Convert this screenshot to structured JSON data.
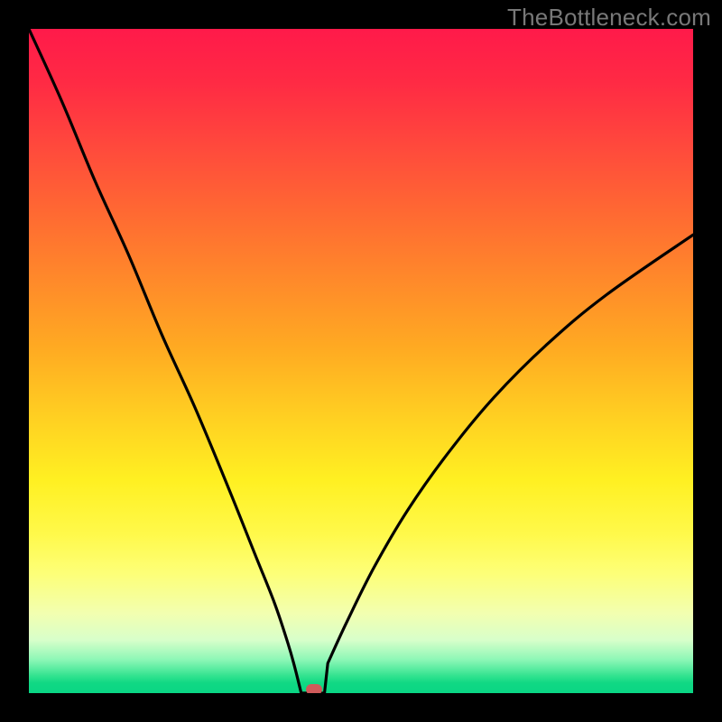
{
  "watermark": "TheBottleneck.com",
  "colors": {
    "frame": "#000000",
    "curve": "#000000",
    "marker": "#cf5a5a",
    "gradient_top": "#ff1a4a",
    "gradient_bottom": "#0ad684"
  },
  "chart_data": {
    "type": "line",
    "title": "",
    "xlabel": "",
    "ylabel": "",
    "xlim": [
      0,
      100
    ],
    "ylim": [
      0,
      100
    ],
    "grid": false,
    "legend": false,
    "x_min": 41,
    "marker": {
      "x": 43,
      "y": 0
    },
    "series": [
      {
        "name": "bottleneck_curve",
        "x": [
          0,
          5,
          10,
          15,
          20,
          25,
          30,
          34,
          37,
          39,
          40,
          41,
          43,
          45,
          48,
          52,
          57,
          63,
          70,
          78,
          87,
          100
        ],
        "y": [
          100,
          89,
          77,
          66,
          54,
          43,
          31,
          21,
          13.5,
          7.5,
          4,
          0,
          0,
          4.5,
          11,
          19,
          27.5,
          36,
          44.5,
          52.5,
          60,
          69
        ]
      }
    ],
    "flat_bottom": {
      "x_start": 41,
      "x_end": 44.5,
      "y": 0
    }
  }
}
